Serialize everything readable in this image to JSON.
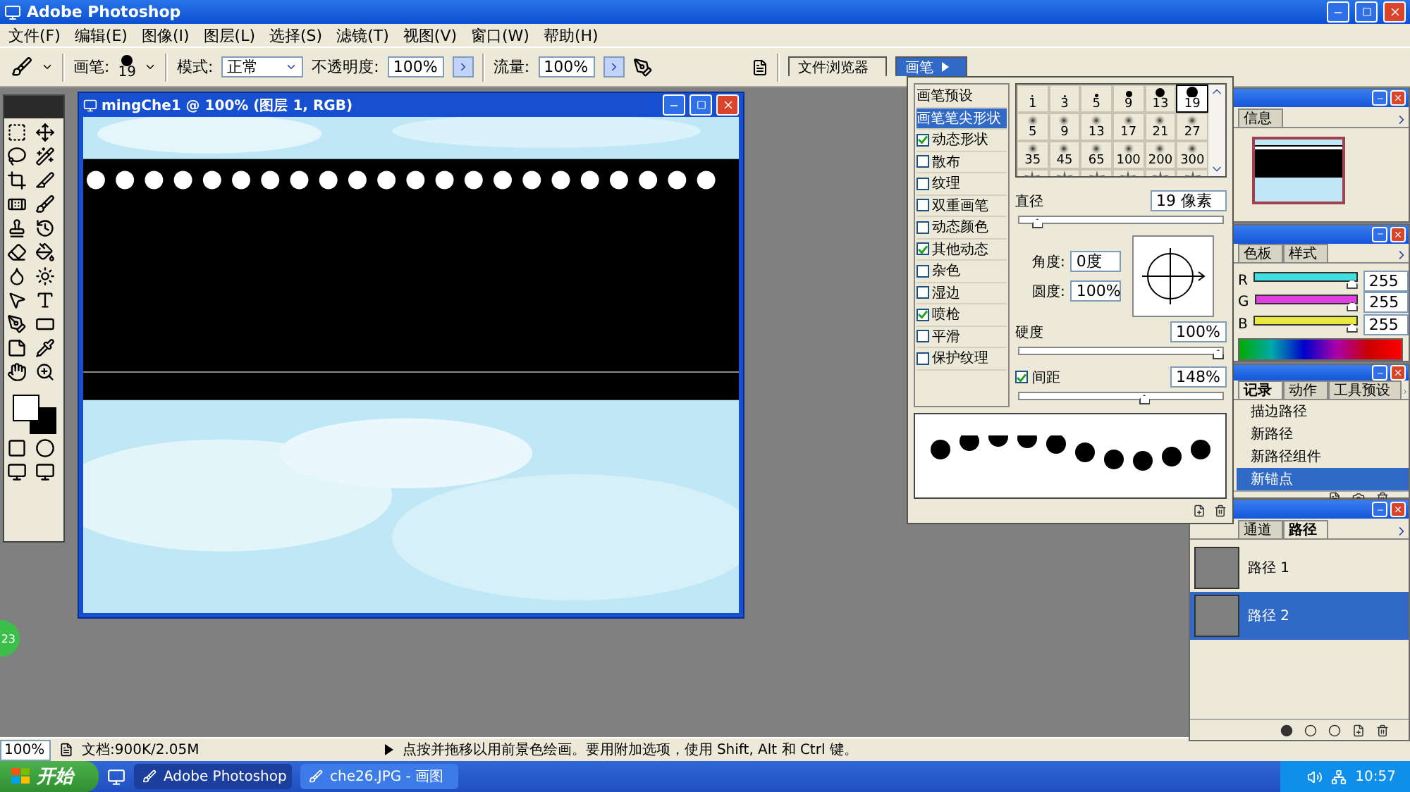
{
  "app_title": "Adobe Photoshop",
  "menu": [
    {
      "label": "文件(F)"
    },
    {
      "label": "编辑(E)"
    },
    {
      "label": "图像(I)"
    },
    {
      "label": "图层(L)"
    },
    {
      "label": "选择(S)"
    },
    {
      "label": "滤镜(T)"
    },
    {
      "label": "视图(V)"
    },
    {
      "label": "窗口(W)"
    },
    {
      "label": "帮助(H)"
    }
  ],
  "options_bar": {
    "brush_label": "画笔:",
    "brush_size": "19",
    "mode_label": "模式:",
    "mode_value": "正常",
    "opacity_label": "不透明度:",
    "opacity_value": "100%",
    "flow_label": "流量:",
    "flow_value": "100%"
  },
  "palette_well": [
    {
      "label": "文件浏览器",
      "selected": false
    },
    {
      "label": "画笔",
      "selected": true
    }
  ],
  "document": {
    "title": "mingChe1 @ 100% (图层 1, RGB)"
  },
  "brushes": {
    "options": [
      {
        "kind": "plain",
        "label": "画笔预设",
        "selected": false
      },
      {
        "kind": "plain",
        "label": "画笔笔尖形状",
        "selected": true
      },
      {
        "kind": "check",
        "label": "动态形状",
        "checked": true,
        "selected": false
      },
      {
        "kind": "check",
        "label": "散布",
        "checked": false,
        "selected": false
      },
      {
        "kind": "check",
        "label": "纹理",
        "checked": false,
        "selected": false
      },
      {
        "kind": "check",
        "label": "双重画笔",
        "checked": false,
        "selected": false
      },
      {
        "kind": "check",
        "label": "动态颜色",
        "checked": false,
        "selected": false
      },
      {
        "kind": "check",
        "label": "其他动态",
        "checked": true,
        "selected": false
      },
      {
        "kind": "check",
        "label": "杂色",
        "checked": false,
        "selected": false
      },
      {
        "kind": "check",
        "label": "湿边",
        "checked": false,
        "selected": false
      },
      {
        "kind": "check",
        "label": "喷枪",
        "checked": true,
        "selected": false
      },
      {
        "kind": "check",
        "label": "平滑",
        "checked": false,
        "selected": false
      },
      {
        "kind": "check",
        "label": "保护纹理",
        "checked": false,
        "selected": false
      }
    ],
    "tips": [
      {
        "kind": "hard",
        "size": "1",
        "selected": false
      },
      {
        "kind": "hard",
        "size": "3",
        "selected": false
      },
      {
        "kind": "hard",
        "size": "5",
        "selected": false
      },
      {
        "kind": "hard",
        "size": "9",
        "selected": false
      },
      {
        "kind": "hard",
        "size": "13",
        "selected": false
      },
      {
        "kind": "hard",
        "size": "19",
        "selected": true
      },
      {
        "kind": "soft",
        "size": "5",
        "selected": false
      },
      {
        "kind": "soft",
        "size": "9",
        "selected": false
      },
      {
        "kind": "soft",
        "size": "13",
        "selected": false
      },
      {
        "kind": "soft",
        "size": "17",
        "selected": false
      },
      {
        "kind": "soft",
        "size": "21",
        "selected": false
      },
      {
        "kind": "soft",
        "size": "27",
        "selected": false
      },
      {
        "kind": "soft",
        "size": "35",
        "selected": false
      },
      {
        "kind": "soft",
        "size": "45",
        "selected": false
      },
      {
        "kind": "soft",
        "size": "65",
        "selected": false
      },
      {
        "kind": "soft",
        "size": "100",
        "selected": false
      },
      {
        "kind": "soft",
        "size": "200",
        "selected": false
      },
      {
        "kind": "soft",
        "size": "300",
        "selected": false
      },
      {
        "kind": "splat",
        "selected": false
      },
      {
        "kind": "splat",
        "selected": false
      },
      {
        "kind": "splat",
        "selected": false
      },
      {
        "kind": "splat",
        "selected": false
      },
      {
        "kind": "splat",
        "selected": false
      },
      {
        "kind": "splat",
        "selected": false
      }
    ],
    "diameter": {
      "label": "直径",
      "value": "19 像素",
      "level": 0.07
    },
    "angle": {
      "label": "角度:",
      "value": "0度"
    },
    "roundness": {
      "label": "圆度:",
      "value": "100%"
    },
    "hardness": {
      "label": "硬度",
      "value": "100%",
      "level": 1
    },
    "spacing": {
      "label": "间距",
      "checked": true,
      "value": "148%",
      "level": 0.62
    }
  },
  "navigator": {
    "tabs": [
      {
        "label": "信息",
        "selected": false
      }
    ]
  },
  "color": {
    "tabs": [
      {
        "label": "色板",
        "selected": false
      },
      {
        "label": "样式",
        "selected": false
      }
    ],
    "channels": [
      {
        "label": "R",
        "value": "255",
        "level": 1,
        "color": "#40e0e0"
      },
      {
        "label": "G",
        "value": "255",
        "level": 1,
        "color": "#e040e0"
      },
      {
        "label": "B",
        "value": "255",
        "level": 1,
        "color": "#e8e840"
      }
    ]
  },
  "history": {
    "tabs": [
      {
        "label": "记录",
        "selected": true
      },
      {
        "label": "动作",
        "selected": false
      },
      {
        "label": "工具预设",
        "selected": false
      }
    ],
    "items": [
      {
        "label": "描边路径",
        "selected": false
      },
      {
        "label": "新路径",
        "selected": false
      },
      {
        "label": "新路径组件",
        "selected": false
      },
      {
        "label": "新锚点",
        "selected": true
      }
    ]
  },
  "paths": {
    "tabs": [
      {
        "label": "通道",
        "selected": false
      },
      {
        "label": "路径",
        "selected": true
      }
    ],
    "items": [
      {
        "label": "路径 1",
        "selected": false
      },
      {
        "label": "路径 2",
        "selected": true
      }
    ]
  },
  "badge": "23",
  "status_bar": {
    "zoom": "100%",
    "doc": "文档:900K/2.05M",
    "hint": "点按并拖移以用前景色绘画。要用附加选项，使用 Shift, Alt 和 Ctrl 键。"
  },
  "taskbar": {
    "start": "开始",
    "tasks": [
      {
        "label": "Adobe Photoshop",
        "selected": true
      },
      {
        "label": "che26.JPG - 画图",
        "selected": false
      }
    ],
    "clock": "10:57"
  }
}
